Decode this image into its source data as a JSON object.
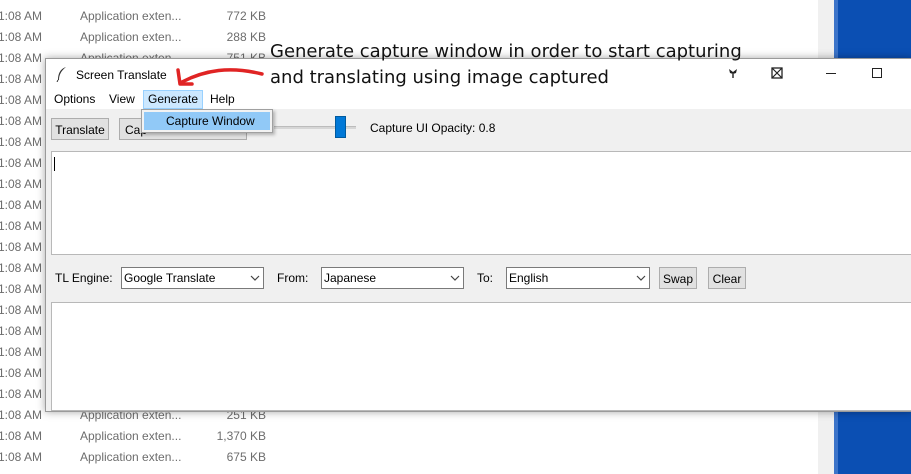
{
  "background_list": {
    "rows": [
      {
        "time": "1:08 AM",
        "type": "Application exten...",
        "size": "772 KB"
      },
      {
        "time": "1:08 AM",
        "type": "Application exten...",
        "size": "288 KB"
      },
      {
        "time": "1:08 AM",
        "type": "Application exten...",
        "size": "751 KB"
      },
      {
        "time": "1:08 AM",
        "type": "",
        "size": ""
      },
      {
        "time": "1:08 AM",
        "type": "",
        "size": ""
      },
      {
        "time": "1:08 AM",
        "type": "",
        "size": ""
      },
      {
        "time": "1:08 AM",
        "type": "",
        "size": ""
      },
      {
        "time": "1:08 AM",
        "type": "",
        "size": ""
      },
      {
        "time": "1:08 AM",
        "type": "",
        "size": ""
      },
      {
        "time": "1:08 AM",
        "type": "",
        "size": ""
      },
      {
        "time": "1:08 AM",
        "type": "",
        "size": ""
      },
      {
        "time": "1:08 AM",
        "type": "",
        "size": ""
      },
      {
        "time": "1:08 AM",
        "type": "",
        "size": ""
      },
      {
        "time": "1:08 AM",
        "type": "",
        "size": ""
      },
      {
        "time": "1:08 AM",
        "type": "",
        "size": ""
      },
      {
        "time": "1:08 AM",
        "type": "",
        "size": ""
      },
      {
        "time": "1:08 AM",
        "type": "",
        "size": ""
      },
      {
        "time": "1:08 AM",
        "type": "",
        "size": ""
      },
      {
        "time": "1:08 AM",
        "type": "",
        "size": ""
      },
      {
        "time": "1:08 AM",
        "type": "Application exten...",
        "size": "251 KB"
      },
      {
        "time": "1:08 AM",
        "type": "Application exten...",
        "size": "1,370 KB"
      },
      {
        "time": "1:08 AM",
        "type": "Application exten...",
        "size": "675 KB"
      }
    ]
  },
  "annotation": {
    "line1": "Generate capture window in order to start capturing",
    "line2": "and translating using image captured",
    "arrow_color": "#e02424"
  },
  "window": {
    "title": "Screen Translate",
    "icon": "feather-icon",
    "titlebar_buttons": [
      "pin-icon",
      "hide-icon",
      "minimize-icon",
      "maximize-icon"
    ]
  },
  "menu": {
    "items": [
      "Options",
      "View",
      "Generate",
      "Help"
    ],
    "active": "Generate",
    "dropdown_items": [
      "Capture Window"
    ]
  },
  "toolbar": {
    "translate_label": "Translate",
    "capture_label": "Cap",
    "opacity_label": "Capture UI Opacity: 0.8",
    "opacity_value": 0.8,
    "accent": "#0078d7"
  },
  "engine_bar": {
    "engine_label": "TL Engine:",
    "engine_value": "Google Translate",
    "from_label": "From:",
    "from_value": "Japanese",
    "to_label": "To:",
    "to_value": "English",
    "swap_label": "Swap",
    "clear_label": "Clear"
  }
}
